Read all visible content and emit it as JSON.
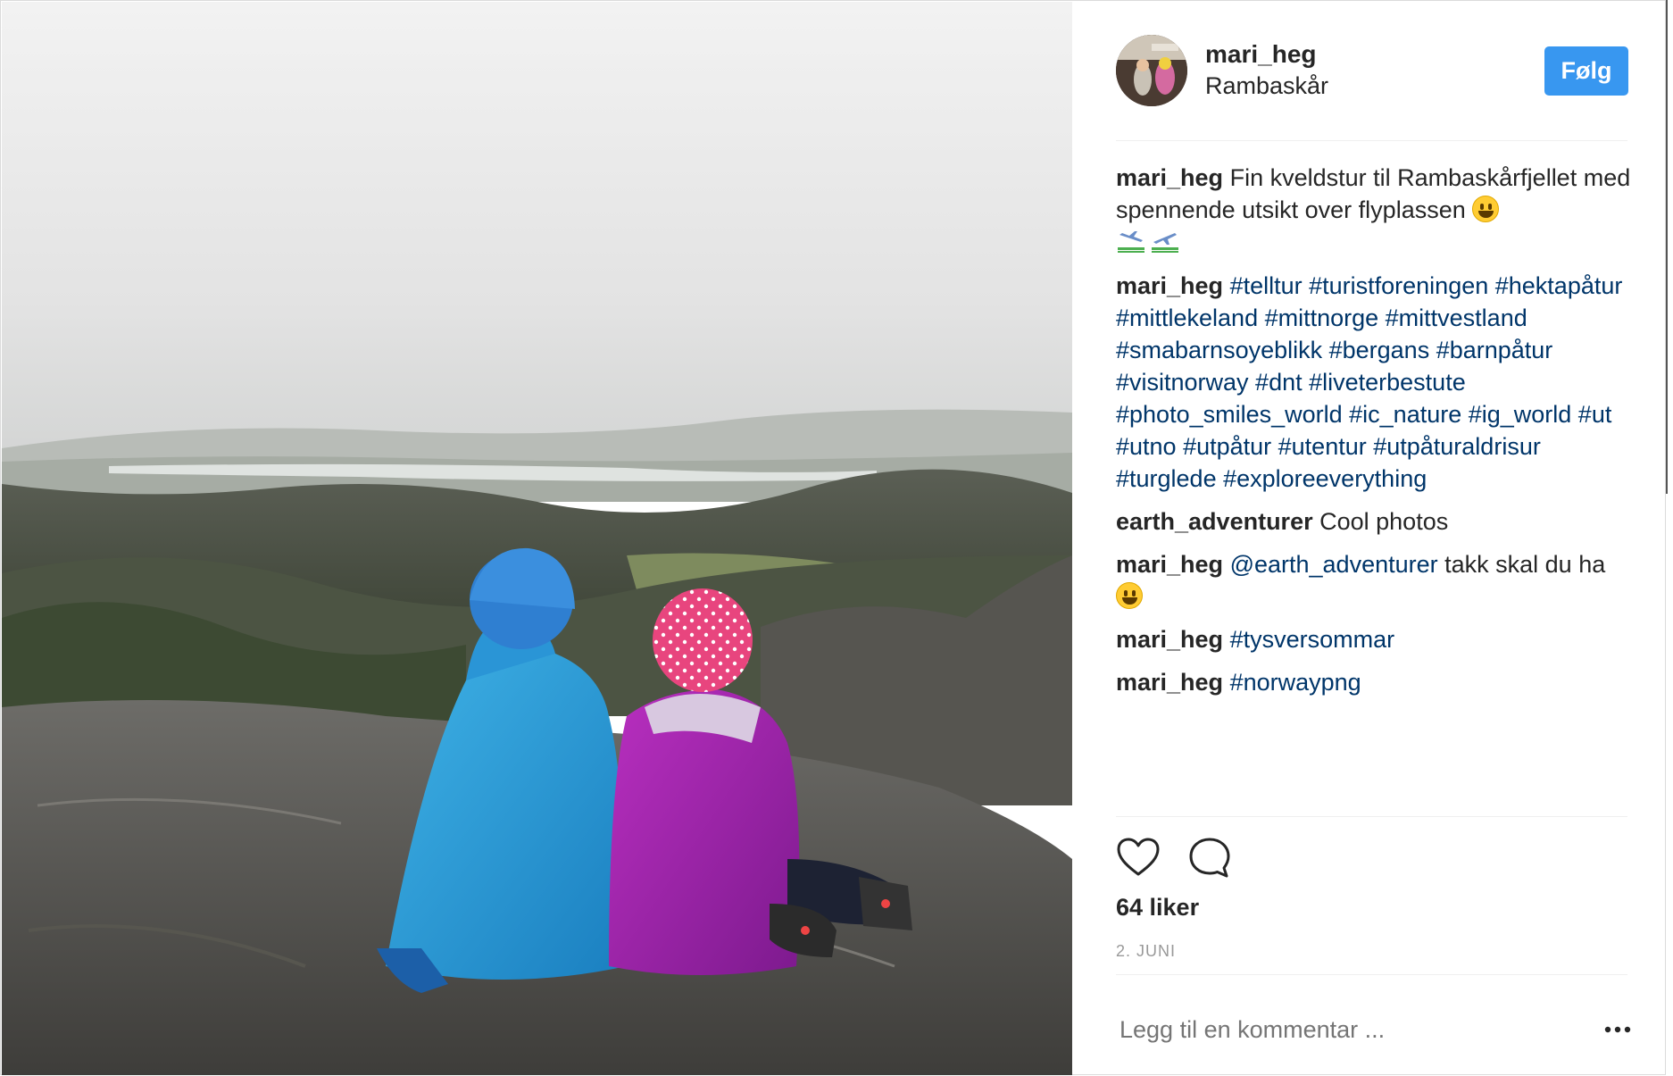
{
  "post": {
    "user": {
      "username": "mari_heg",
      "location": "Rambaskår",
      "follow_label": "Følg"
    },
    "photo": {
      "description_icon": "photo-of-two-children-on-mountain"
    },
    "comments": [
      {
        "user": "mari_heg",
        "text": "Fin kveldstur til Rambaskårfjellet med spennende utsikt over flyplassen",
        "emojis": [
          "smiley",
          "airplane-arriving",
          "airplane-departing"
        ]
      },
      {
        "user": "mari_heg",
        "hashtags": "#telltur #turistforeningen #hektapåtur #mittlekeland #mittnorge #mittvestland #smabarnsoyeblikk #bergans #barnpåtur #visitnorway #dnt #liveterbestute #photo_smiles_world #ic_nature #ig_world #ut #utno #utpåtur #utentur #utpåturaldrisur #turglede #exploreeverything"
      },
      {
        "user": "earth_adventurer",
        "text": "Cool photos"
      },
      {
        "user": "mari_heg",
        "mention": "@earth_adventurer",
        "text": " takk skal du ha",
        "emojis": [
          "smiley"
        ]
      },
      {
        "user": "mari_heg",
        "hashtags": "#tysversommar"
      },
      {
        "user": "mari_heg",
        "hashtags": "#norwaypng"
      }
    ],
    "actions": {
      "like_icon": "heart-icon",
      "comment_icon": "comment-bubble-icon"
    },
    "likes": "64 liker",
    "date": "2. JUNI",
    "comment_input": {
      "placeholder": "Legg til en kommentar ..."
    },
    "more_icon": "more-options-icon"
  },
  "colors": {
    "follow_button": "#3897f0",
    "hashtag": "#003569",
    "text": "#262626",
    "muted": "#999999"
  }
}
